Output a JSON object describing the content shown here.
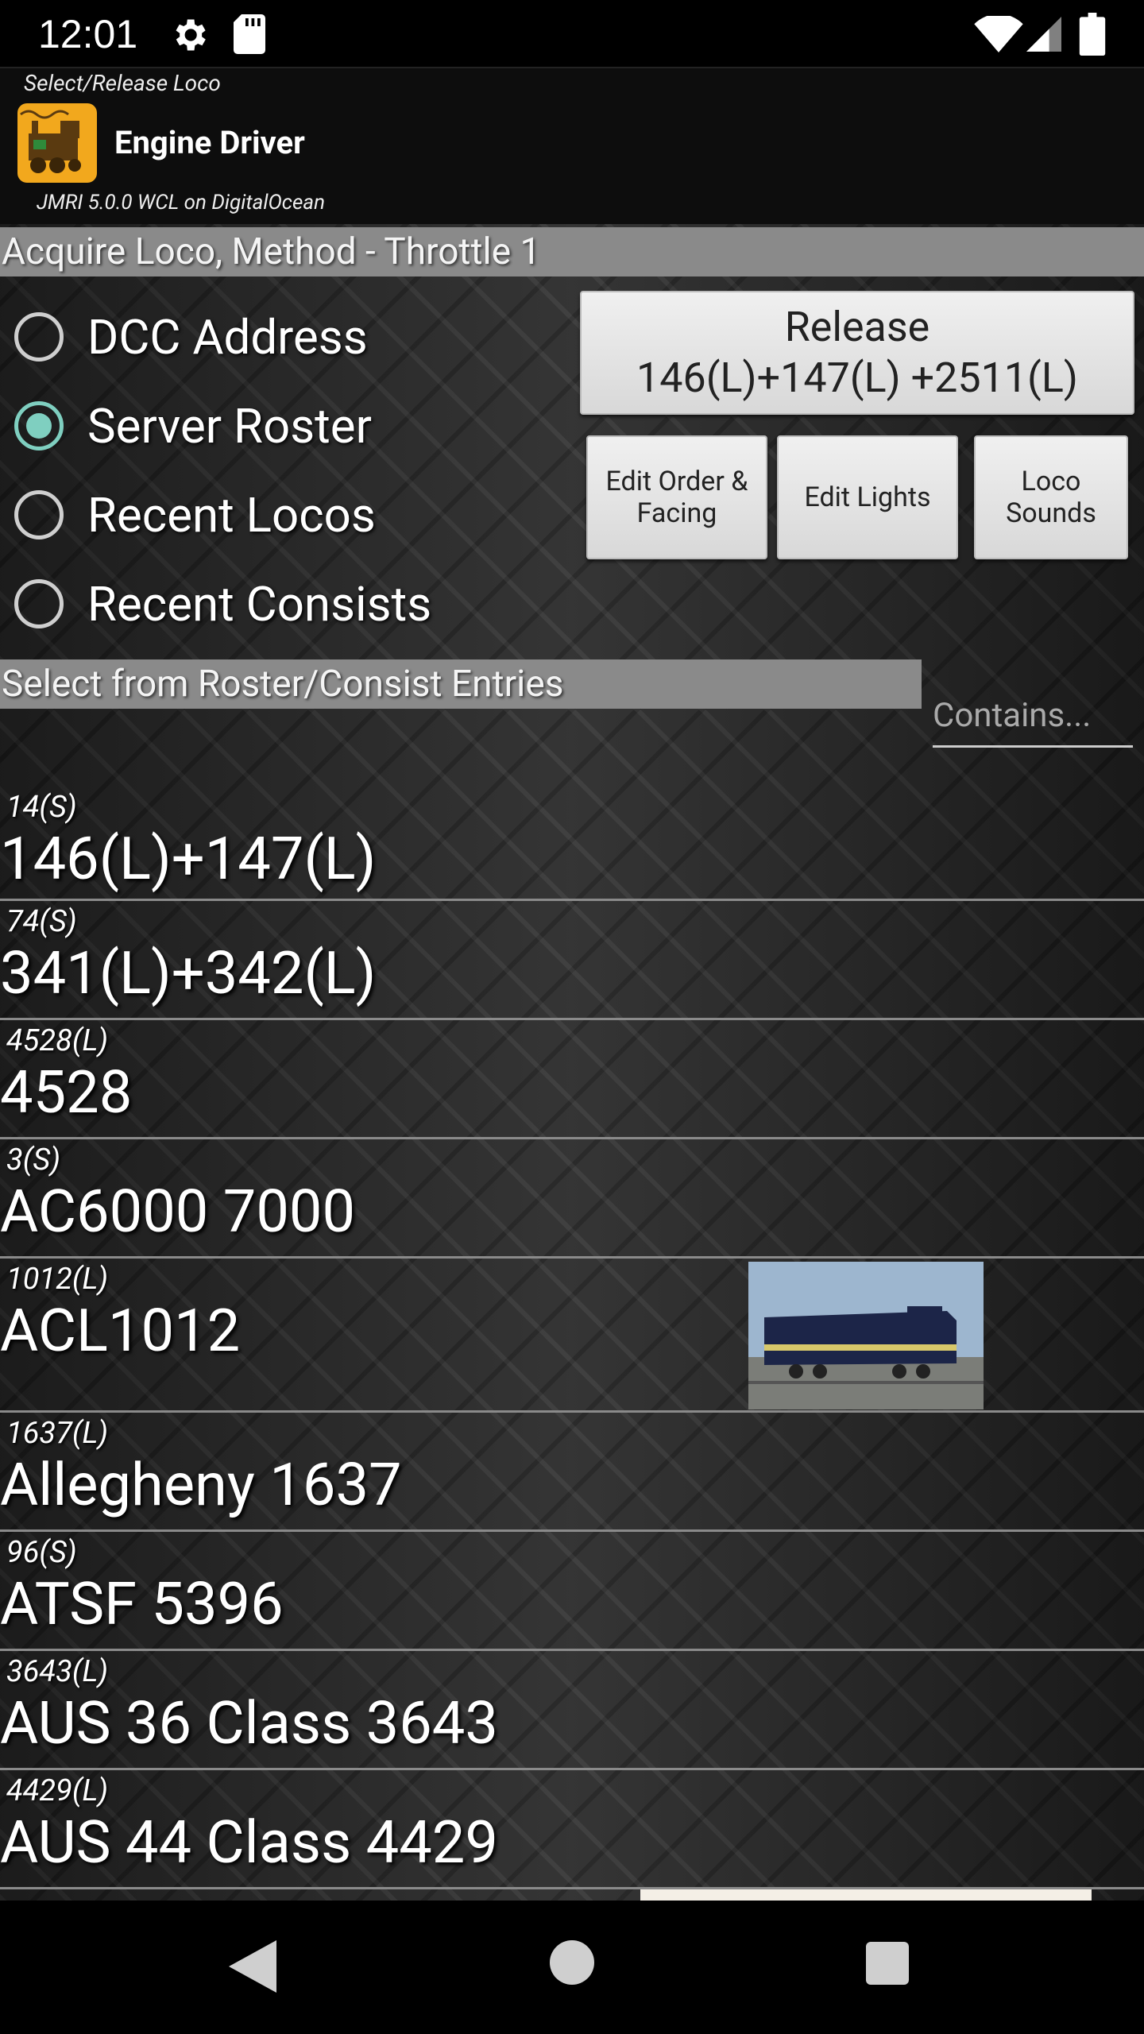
{
  "status": {
    "time": "12:01"
  },
  "header": {
    "subtitle": "Select/Release Loco",
    "title": "Engine Driver",
    "server": "JMRI 5.0.0 WCL on DigitalOcean"
  },
  "method": {
    "heading": "Acquire Loco, Method - Throttle 1",
    "options": [
      "DCC Address",
      "Server Roster",
      "Recent Locos",
      "Recent Consists"
    ],
    "selected": "Server Roster"
  },
  "buttons": {
    "release_line1": "Release",
    "release_line2": "146(L)+147(L) +2511(L)",
    "edit_order_line1": "Edit Order &",
    "edit_order_line2": "Facing",
    "edit_lights": "Edit Lights",
    "loco_sounds_line1": "Loco",
    "loco_sounds_line2": "Sounds"
  },
  "roster": {
    "heading": "Select from Roster/Consist Entries",
    "filter_placeholder": "Contains...",
    "entries": [
      {
        "id": "14(S)",
        "name": "146(L)+147(L)"
      },
      {
        "id": "74(S)",
        "name": "341(L)+342(L)"
      },
      {
        "id": "4528(L)",
        "name": "4528"
      },
      {
        "id": "3(S)",
        "name": "AC6000 7000"
      },
      {
        "id": "1012(L)",
        "name": "ACL1012",
        "has_photo": true
      },
      {
        "id": "1637(L)",
        "name": "Allegheny 1637"
      },
      {
        "id": "96(S)",
        "name": "ATSF 5396"
      },
      {
        "id": "3643(L)",
        "name": "AUS 36 Class 3643"
      },
      {
        "id": "4429(L)",
        "name": "AUS 44 Class 4429"
      }
    ]
  },
  "colors": {
    "accent": "#7fcfc0",
    "section_bar": "#8a8a8a"
  }
}
